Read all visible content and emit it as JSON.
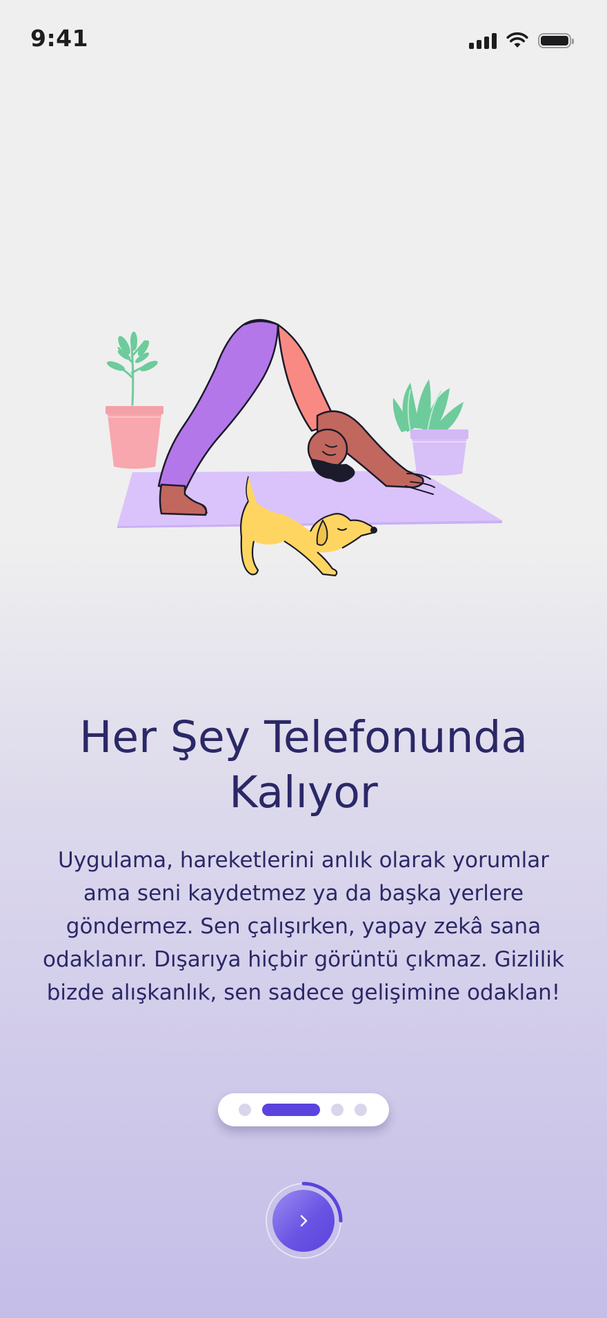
{
  "status_bar": {
    "time": "9:41"
  },
  "onboarding": {
    "title": "Her Şey Telefonunda Kalıyor",
    "description": "Uygulama, hareketlerini anlık olarak yorumlar ama seni kaydetmez ya da başka yerlere göndermez. Sen çalışırken, yapay zekâ sana odaklanır. Dışarıya hiçbir görüntü çıkmaz. Gizlilik bizde alışkanlık, sen sadece gelişimine odaklan!",
    "pager": {
      "total_pages": 4,
      "current_page": 2
    },
    "next_button": {
      "icon": "chevron-right-icon",
      "progress": 0.25
    }
  },
  "colors": {
    "text": "#2b2867",
    "accent": "#5b43de",
    "inactive_dot": "#d8d6ea",
    "background_top": "#efefef",
    "background_bottom": "#c4bde8"
  }
}
